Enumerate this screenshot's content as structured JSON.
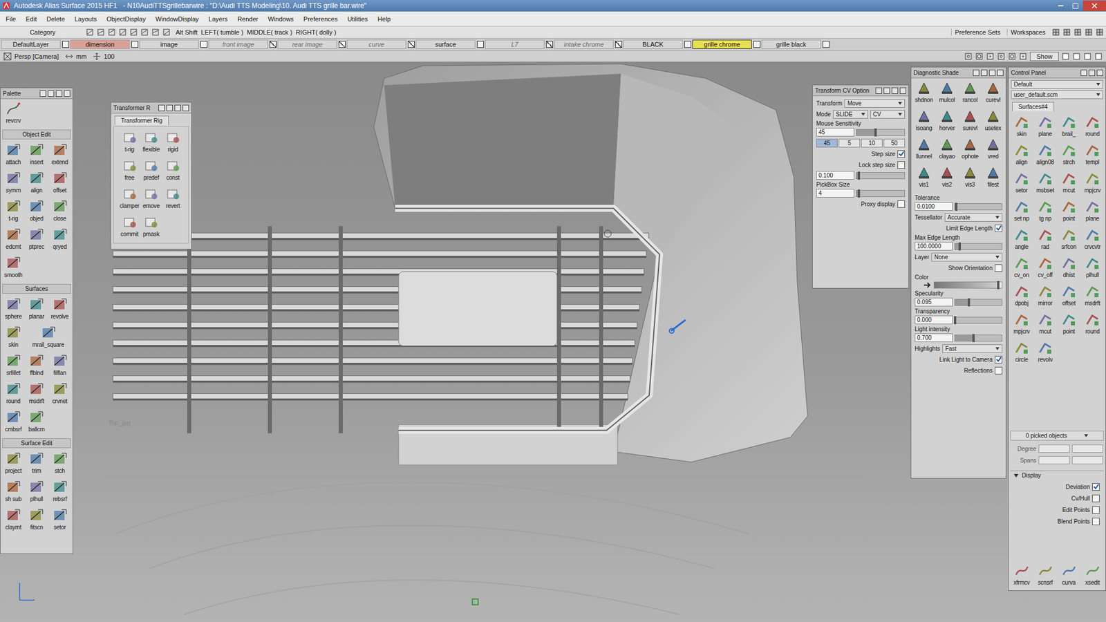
{
  "window": {
    "title": "Autodesk Alias Surface 2015 HF1   - N10AudiTTSgrillebarwire : \"D:\\Audi TTS Modeling\\10. Audi TTS grille bar.wire\""
  },
  "menu": [
    "File",
    "Edit",
    "Delete",
    "Layouts",
    "ObjectDisplay",
    "WindowDisplay",
    "Layers",
    "Render",
    "Windows",
    "Preferences",
    "Utilities",
    "Help"
  ],
  "shelf": {
    "category": "Category",
    "hint": "Alt Shift  LEFT( tumble )  MIDDLE( track )  RIGHT( dolly )",
    "right": [
      "Preference Sets",
      "Workspaces"
    ]
  },
  "layers": [
    {
      "label": "DefaultLayer",
      "selected": false,
      "hidden": false,
      "color": "#d6d6d6"
    },
    {
      "label": "dimension",
      "selected": false,
      "hidden": false,
      "color": "#d9a096"
    },
    {
      "label": "image",
      "selected": false,
      "hidden": false,
      "color": "#d6d6d6"
    },
    {
      "label": "front image",
      "selected": false,
      "hidden": true,
      "color": "#d6d6d6"
    },
    {
      "label": "rear image",
      "selected": false,
      "hidden": true,
      "color": "#d6d6d6"
    },
    {
      "label": "curve",
      "selected": false,
      "hidden": true,
      "color": "#d6d6d6"
    },
    {
      "label": "surface",
      "selected": false,
      "hidden": false,
      "color": "#d6d6d6"
    },
    {
      "label": "L7",
      "selected": false,
      "hidden": true,
      "color": "#d6d6d6"
    },
    {
      "label": "intake chrome",
      "selected": false,
      "hidden": true,
      "color": "#d6d6d6"
    },
    {
      "label": "BLACK",
      "selected": false,
      "hidden": false,
      "color": "#d6d6d6"
    },
    {
      "label": "grille chrome",
      "selected": true,
      "hidden": false,
      "color": "#e8df55"
    },
    {
      "label": "grille black",
      "selected": false,
      "hidden": false,
      "color": "#d6d6d6"
    }
  ],
  "viewport": {
    "camera": "Persp [Camera]",
    "units": "mm",
    "zoom": "100",
    "show": "Show",
    "watermark": "Top_jpg"
  },
  "palette": {
    "title": "Palette",
    "top": [
      "revcrv"
    ],
    "sections": [
      {
        "title": "Object Edit",
        "tools": [
          "attach",
          "insert",
          "extend",
          "symm",
          "align",
          "offset",
          "t-rig",
          "objed",
          "close",
          "edcmt",
          "ptprec",
          "qryed",
          "smooth"
        ]
      },
      {
        "title": "Surfaces",
        "tools": [
          "sphere",
          "planar",
          "revolve",
          "skin",
          "mrail_square",
          "srfillet",
          "ffblnd",
          "filflan",
          "round",
          "msdrft",
          "crvnet",
          "cmbsrf",
          "ballcrn"
        ]
      },
      {
        "title": "Surface Edit",
        "tools": [
          "project",
          "trim",
          "stch",
          "sh sub",
          "plhull",
          "rebsrf",
          "claymt",
          "fitscn",
          "setor"
        ]
      }
    ]
  },
  "transformer": {
    "title": "Transformer R",
    "tab": "Transformer Rig",
    "tools": [
      "t-rig",
      "flexible",
      "rigid",
      "free",
      "predef",
      "const",
      "clamper",
      "emove",
      "revert",
      "commit",
      "pmask"
    ]
  },
  "cvOptions": {
    "title": "Transform CV Option",
    "rows": [
      {
        "kind": "dropdown",
        "label": "Transform",
        "value": "Move"
      },
      {
        "kind": "dual",
        "label": "Mode",
        "values": [
          "SLIDE",
          "CV"
        ]
      },
      {
        "kind": "slider",
        "label": "Mouse Sensitivity",
        "value": "45",
        "level": 0.4
      },
      {
        "kind": "buttons",
        "buttons": [
          {
            "label": "45",
            "selected": true
          },
          {
            "label": "5",
            "selected": false
          },
          {
            "label": "10",
            "selected": false
          },
          {
            "label": "50",
            "selected": false
          }
        ]
      },
      {
        "kind": "checkbox",
        "label": "Step size",
        "checked": true
      },
      {
        "kind": "checkbox",
        "label": "Lock step size",
        "checked": false
      },
      {
        "kind": "field",
        "value": "0.100",
        "level": 0.05
      },
      {
        "kind": "slider",
        "label": "PickBox Size",
        "value": "4",
        "level": 0.05
      },
      {
        "kind": "checkbox",
        "label": "Proxy display",
        "checked": false
      }
    ]
  },
  "diagnostic": {
    "title": "Diagnostic Shade",
    "tools": [
      "shdnon",
      "mulcol",
      "rancol",
      "curevl",
      "isoang",
      "horver",
      "surevl",
      "usetex",
      "llunnel",
      "clayao",
      "ophote",
      "vred",
      "vis1",
      "vis2",
      "vis3",
      "filest"
    ],
    "rows": [
      {
        "kind": "slider",
        "label": "Tolerance",
        "value": "0.0100",
        "level": 0.03
      },
      {
        "kind": "dropdown",
        "label": "Tessellator",
        "value": "Accurate"
      },
      {
        "kind": "checkbox",
        "label": "Limit Edge Length",
        "checked": true
      },
      {
        "kind": "slider",
        "label": "Max Edge Length",
        "value": "100.0000",
        "level": 0.1
      },
      {
        "kind": "dropdown",
        "label": "Layer",
        "value": "None"
      },
      {
        "kind": "checkbox",
        "label": "Show Orientation",
        "checked": false
      },
      {
        "kind": "color",
        "label": "Color",
        "level": 0.95
      },
      {
        "kind": "slider",
        "label": "Specularity",
        "value": "0.095",
        "level": 0.3
      },
      {
        "kind": "slider",
        "label": "Transparency",
        "value": "0.000",
        "level": 0.0
      },
      {
        "kind": "slider",
        "label": "Light intensity",
        "value": "0.700",
        "level": 0.4
      },
      {
        "kind": "dropdown",
        "label": "Highlights",
        "value": "Fast"
      },
      {
        "kind": "checkbox",
        "label": "Link Light to Camera",
        "checked": true
      },
      {
        "kind": "checkbox",
        "label": "Reflections",
        "checked": false
      }
    ]
  },
  "control": {
    "title": "Control Panel",
    "presets": [
      "Default",
      "user_default.scm"
    ],
    "tab": "Surfaces#4",
    "tools": [
      "skin",
      "plane",
      "brail_",
      "round",
      "align",
      "align08",
      "strch",
      "templ",
      "setor",
      "msbset",
      "mcut",
      "mpjcrv",
      "set np",
      "tg np",
      "point",
      "plane",
      "angle",
      "rad",
      "srfcon",
      "crvcvtr",
      "cv_on",
      "cv_off",
      "dhist",
      "plhull",
      "dpobj",
      "mirror",
      "offset",
      "msdrft",
      "mpjcrv",
      "mcut",
      "point",
      "round",
      "circle",
      "revolv"
    ],
    "picked": "0 picked objects",
    "fields": [
      "Degree",
      "Spans"
    ],
    "display": {
      "title": "Display",
      "expanded": true,
      "options": [
        {
          "label": "Deviation",
          "checked": true
        },
        {
          "label": "Cv/Hull",
          "checked": false
        },
        {
          "label": "Edit Points",
          "checked": false
        },
        {
          "label": "Blend Points",
          "checked": false
        }
      ]
    },
    "bottomTools": [
      "xfrmcv",
      "scnsrf",
      "curva",
      "xsedit"
    ]
  }
}
